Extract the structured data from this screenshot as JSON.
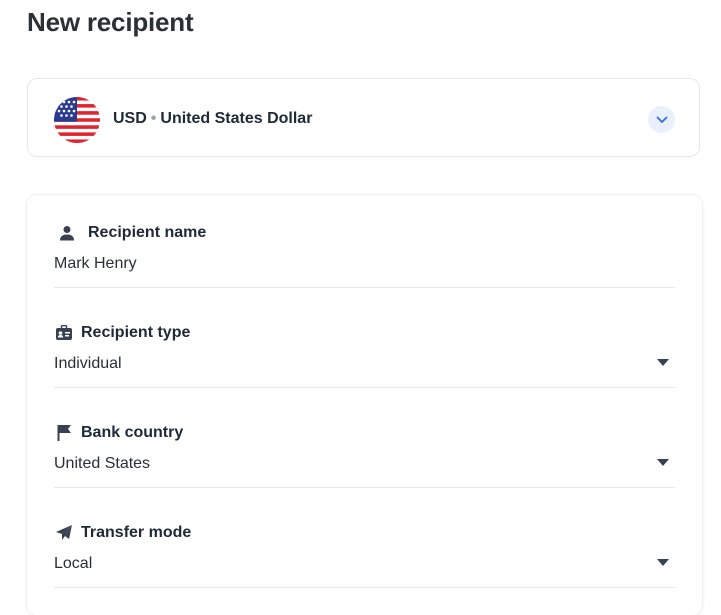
{
  "page": {
    "title": "New recipient"
  },
  "currency": {
    "code": "USD",
    "separator": "•",
    "name": "United States Dollar",
    "flag_icon": "us-flag-icon",
    "chevron_icon": "chevron-down-icon"
  },
  "form": {
    "recipient_name": {
      "label": "Recipient name",
      "value": "Mark Henry",
      "icon": "person-icon"
    },
    "recipient_type": {
      "label": "Recipient type",
      "value": "Individual",
      "icon": "id-card-icon"
    },
    "bank_country": {
      "label": "Bank country",
      "value": "United States",
      "icon": "flag-icon"
    },
    "transfer_mode": {
      "label": "Transfer mode",
      "value": "Local",
      "icon": "paper-plane-icon"
    }
  },
  "colors": {
    "text_primary": "#1f2937",
    "border": "#e5e7eb",
    "accent": "#2f6fd6",
    "chevron_bg": "#e9f0fb"
  }
}
